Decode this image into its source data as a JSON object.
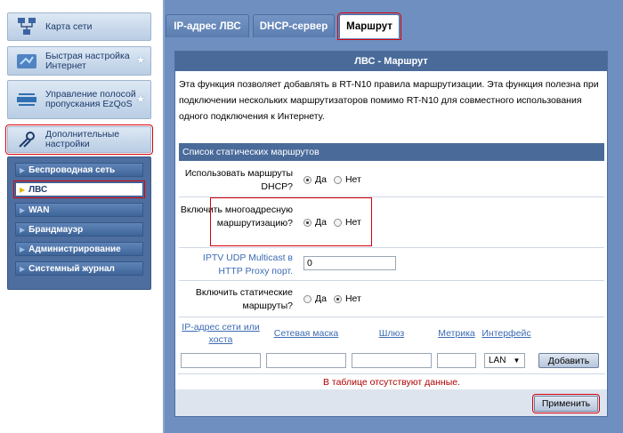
{
  "sidebar": {
    "main_items": [
      {
        "label": "Карта сети",
        "icon": "network-map-icon"
      },
      {
        "label": "Быстрая настройка Интернет",
        "icon": "quick-setup-icon"
      },
      {
        "label": "Управление полосой пропускания EzQoS",
        "icon": "bandwidth-icon"
      },
      {
        "label": "Дополнительные настройки",
        "icon": "wrench-icon"
      }
    ],
    "sub_items": [
      {
        "label": "Беспроводная сеть"
      },
      {
        "label": "ЛВС"
      },
      {
        "label": "WAN"
      },
      {
        "label": "Брандмауэр"
      },
      {
        "label": "Администрирование"
      },
      {
        "label": "Системный журнал"
      }
    ]
  },
  "tabs": [
    {
      "label": "IP-адрес ЛВС"
    },
    {
      "label": "DHCP-сервер"
    },
    {
      "label": "Маршрут"
    }
  ],
  "panel": {
    "title": "ЛВС - Маршрут",
    "description": "Эта функция позволяет добавлять в RT-N10 правила маршрутизации. Эта функция полезна при подключении нескольких маршрутизаторов помимо RT-N10 для совместного использования одного подключения к Интернету.",
    "list_header": "Список статических маршрутов",
    "fields": {
      "dhcp_routes": {
        "label": "Использовать маршруты DHCP?",
        "yes": "Да",
        "no": "Нет",
        "selected": "yes"
      },
      "multicast": {
        "label": "Включить многоадресную маршрутизацию?",
        "yes": "Да",
        "no": "Нет",
        "selected": "yes"
      },
      "iptv": {
        "label": "IPTV UDP Multicast в HTTP Proxy порт.",
        "value": "0"
      },
      "static_routes": {
        "label": "Включить статические маршруты?",
        "yes": "Да",
        "no": "Нет",
        "selected": "no"
      }
    },
    "table": {
      "columns": [
        "IP-адрес сети или хоста",
        "Сетевая маска",
        "Шлюз",
        "Метрика",
        "Интерфейс"
      ],
      "interface_value": "LAN",
      "add_button": "Добавить",
      "empty_text": "В таблице отсутствуют данные."
    },
    "apply_button": "Применить"
  },
  "colors": {
    "accent": "#4a6b9a",
    "frame": "#6e8fbf",
    "highlight": "#d9000d"
  }
}
